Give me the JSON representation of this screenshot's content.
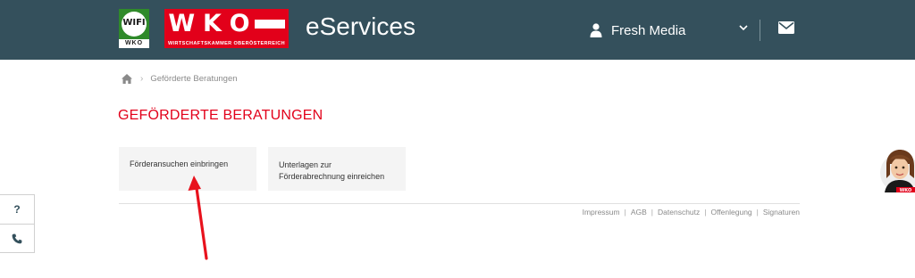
{
  "header": {
    "wifi_logo_text": "WIFI",
    "wifi_logo_strip": "WKO",
    "wko_logo_letters": [
      "W",
      "K",
      "O"
    ],
    "wko_logo_subtitle": "WIRTSCHAFTSKAMMER OBERÖSTERREICH",
    "app_title": "eServices",
    "user_name": "Fresh Media",
    "user_icon": "user-icon",
    "dropdown_icon": "chevron-down-icon",
    "mail_icon": "envelope-icon"
  },
  "breadcrumb": {
    "home_icon": "home-icon",
    "current": "Geförderte Beratungen"
  },
  "main": {
    "title": "GEFÖRDERTE BERATUNGEN",
    "tiles": [
      {
        "label": "Förderansuchen einbringen"
      },
      {
        "label_line1": "Unterlagen zur",
        "label_line2": "Förderabrechnung einreichen"
      }
    ]
  },
  "footer": {
    "links": [
      "Impressum",
      "AGB",
      "Datenschutz",
      "Offenlegung",
      "Signaturen"
    ]
  },
  "side_help": {
    "question_label": "?",
    "phone_icon": "phone-icon"
  },
  "chat": {
    "badge": "WKO"
  },
  "colors": {
    "header_bg": "#34505c",
    "brand_red": "#e2001a",
    "wifi_green": "#2f8a2a",
    "tile_bg": "#f4f4f4",
    "annotation_arrow": "#e8121d"
  }
}
